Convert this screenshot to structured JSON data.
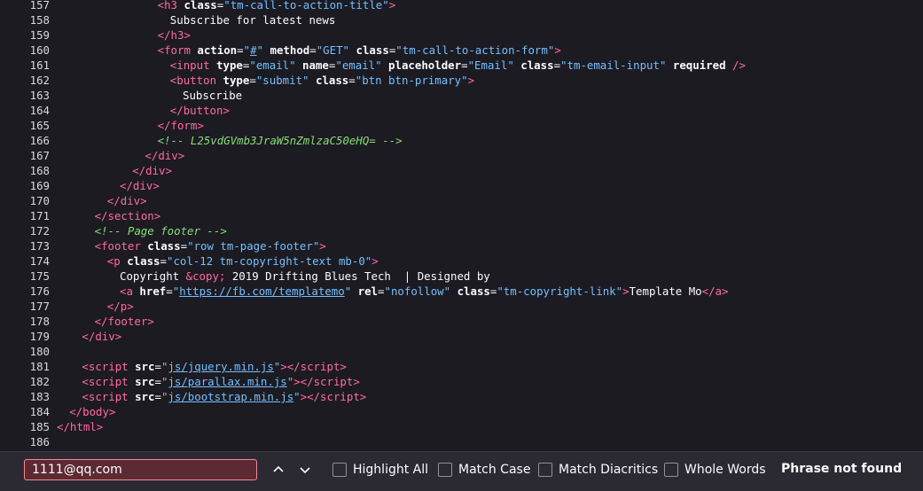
{
  "code": {
    "lines": [
      {
        "n": "157",
        "indent": 16,
        "parts": [
          [
            "b",
            "<"
          ],
          [
            "tag",
            "h3"
          ],
          [
            "t",
            " "
          ],
          [
            "attr",
            "class"
          ],
          [
            "t",
            "="
          ],
          [
            "val",
            "\"tm-call-to-action-title\""
          ],
          [
            "b",
            ">"
          ]
        ]
      },
      {
        "n": "158",
        "indent": 18,
        "parts": [
          [
            "t",
            "Subscribe for latest news"
          ]
        ]
      },
      {
        "n": "159",
        "indent": 16,
        "parts": [
          [
            "b",
            "</"
          ],
          [
            "tag",
            "h3"
          ],
          [
            "b",
            ">"
          ]
        ]
      },
      {
        "n": "160",
        "indent": 16,
        "parts": [
          [
            "b",
            "<"
          ],
          [
            "tag",
            "form"
          ],
          [
            "t",
            " "
          ],
          [
            "attr",
            "action"
          ],
          [
            "t",
            "="
          ],
          [
            "val",
            "\""
          ],
          [
            "lnk",
            "#"
          ],
          [
            "val",
            "\""
          ],
          [
            "t",
            " "
          ],
          [
            "attr",
            "method"
          ],
          [
            "t",
            "="
          ],
          [
            "val",
            "\"GET\""
          ],
          [
            "t",
            " "
          ],
          [
            "attr",
            "class"
          ],
          [
            "t",
            "="
          ],
          [
            "val",
            "\"tm-call-to-action-form\""
          ],
          [
            "b",
            ">"
          ]
        ]
      },
      {
        "n": "161",
        "indent": 18,
        "parts": [
          [
            "b",
            "<"
          ],
          [
            "tag",
            "input"
          ],
          [
            "t",
            " "
          ],
          [
            "attr",
            "type"
          ],
          [
            "t",
            "="
          ],
          [
            "val",
            "\"email\""
          ],
          [
            "t",
            " "
          ],
          [
            "attr",
            "name"
          ],
          [
            "t",
            "="
          ],
          [
            "val",
            "\"email\""
          ],
          [
            "t",
            " "
          ],
          [
            "attr",
            "placeholder"
          ],
          [
            "t",
            "="
          ],
          [
            "val",
            "\"Email\""
          ],
          [
            "t",
            " "
          ],
          [
            "attr",
            "class"
          ],
          [
            "t",
            "="
          ],
          [
            "val",
            "\"tm-email-input\""
          ],
          [
            "t",
            " "
          ],
          [
            "attr",
            "required"
          ],
          [
            "t",
            " "
          ],
          [
            "b",
            "/>"
          ]
        ]
      },
      {
        "n": "162",
        "indent": 18,
        "parts": [
          [
            "b",
            "<"
          ],
          [
            "tag",
            "button"
          ],
          [
            "t",
            " "
          ],
          [
            "attr",
            "type"
          ],
          [
            "t",
            "="
          ],
          [
            "val",
            "\"submit\""
          ],
          [
            "t",
            " "
          ],
          [
            "attr",
            "class"
          ],
          [
            "t",
            "="
          ],
          [
            "val",
            "\"btn btn-primary\""
          ],
          [
            "b",
            ">"
          ]
        ]
      },
      {
        "n": "163",
        "indent": 20,
        "parts": [
          [
            "t",
            "Subscribe"
          ]
        ]
      },
      {
        "n": "164",
        "indent": 18,
        "parts": [
          [
            "b",
            "</"
          ],
          [
            "tag",
            "button"
          ],
          [
            "b",
            ">"
          ]
        ]
      },
      {
        "n": "165",
        "indent": 16,
        "parts": [
          [
            "b",
            "</"
          ],
          [
            "tag",
            "form"
          ],
          [
            "b",
            ">"
          ]
        ]
      },
      {
        "n": "166",
        "indent": 16,
        "parts": [
          [
            "cmt",
            "<!-- L25vdGVmb3JraW5nZmlzaC50eHQ= -->"
          ]
        ]
      },
      {
        "n": "167",
        "indent": 14,
        "parts": [
          [
            "b",
            "</"
          ],
          [
            "tag",
            "div"
          ],
          [
            "b",
            ">"
          ]
        ]
      },
      {
        "n": "168",
        "indent": 12,
        "parts": [
          [
            "b",
            "</"
          ],
          [
            "tag",
            "div"
          ],
          [
            "b",
            ">"
          ]
        ]
      },
      {
        "n": "169",
        "indent": 10,
        "parts": [
          [
            "b",
            "</"
          ],
          [
            "tag",
            "div"
          ],
          [
            "b",
            ">"
          ]
        ]
      },
      {
        "n": "170",
        "indent": 8,
        "parts": [
          [
            "b",
            "</"
          ],
          [
            "tag",
            "div"
          ],
          [
            "b",
            ">"
          ]
        ]
      },
      {
        "n": "171",
        "indent": 6,
        "parts": [
          [
            "b",
            "</"
          ],
          [
            "tag",
            "section"
          ],
          [
            "b",
            ">"
          ]
        ]
      },
      {
        "n": "172",
        "indent": 6,
        "parts": [
          [
            "cmt",
            "<!-- Page footer -->"
          ]
        ]
      },
      {
        "n": "173",
        "indent": 6,
        "parts": [
          [
            "b",
            "<"
          ],
          [
            "tag",
            "footer"
          ],
          [
            "t",
            " "
          ],
          [
            "attr",
            "class"
          ],
          [
            "t",
            "="
          ],
          [
            "val",
            "\"row tm-page-footer\""
          ],
          [
            "b",
            ">"
          ]
        ]
      },
      {
        "n": "174",
        "indent": 8,
        "parts": [
          [
            "b",
            "<"
          ],
          [
            "tag",
            "p"
          ],
          [
            "t",
            " "
          ],
          [
            "attr",
            "class"
          ],
          [
            "t",
            "="
          ],
          [
            "val",
            "\"col-12 tm-copyright-text mb-0\""
          ],
          [
            "b",
            ">"
          ]
        ]
      },
      {
        "n": "175",
        "indent": 10,
        "parts": [
          [
            "t",
            "Copyright "
          ],
          [
            "tag",
            "&copy;"
          ],
          [
            "t",
            " 2019 Drifting Blues Tech  | Designed by"
          ]
        ]
      },
      {
        "n": "176",
        "indent": 10,
        "parts": [
          [
            "b",
            "<"
          ],
          [
            "tag",
            "a"
          ],
          [
            "t",
            " "
          ],
          [
            "attr",
            "href"
          ],
          [
            "t",
            "="
          ],
          [
            "val",
            "\""
          ],
          [
            "lnk",
            "https://fb.com/templatemo"
          ],
          [
            "val",
            "\""
          ],
          [
            "t",
            " "
          ],
          [
            "attr",
            "rel"
          ],
          [
            "t",
            "="
          ],
          [
            "val",
            "\"nofollow\""
          ],
          [
            "t",
            " "
          ],
          [
            "attr",
            "class"
          ],
          [
            "t",
            "="
          ],
          [
            "val",
            "\"tm-copyright-link\""
          ],
          [
            "b",
            ">"
          ],
          [
            "t",
            "Template Mo"
          ],
          [
            "b",
            "</"
          ],
          [
            "tag",
            "a"
          ],
          [
            "b",
            ">"
          ]
        ]
      },
      {
        "n": "177",
        "indent": 8,
        "parts": [
          [
            "b",
            "</"
          ],
          [
            "tag",
            "p"
          ],
          [
            "b",
            ">"
          ]
        ]
      },
      {
        "n": "178",
        "indent": 6,
        "parts": [
          [
            "b",
            "</"
          ],
          [
            "tag",
            "footer"
          ],
          [
            "b",
            ">"
          ]
        ]
      },
      {
        "n": "179",
        "indent": 4,
        "parts": [
          [
            "b",
            "</"
          ],
          [
            "tag",
            "div"
          ],
          [
            "b",
            ">"
          ]
        ]
      },
      {
        "n": "180",
        "indent": 0,
        "parts": []
      },
      {
        "n": "181",
        "indent": 4,
        "parts": [
          [
            "b",
            "<"
          ],
          [
            "tag",
            "script"
          ],
          [
            "t",
            " "
          ],
          [
            "attr",
            "src"
          ],
          [
            "t",
            "="
          ],
          [
            "val",
            "\""
          ],
          [
            "lnk",
            "js/jquery.min.js"
          ],
          [
            "val",
            "\""
          ],
          [
            "b",
            "></"
          ],
          [
            "tag",
            "script"
          ],
          [
            "b",
            ">"
          ]
        ]
      },
      {
        "n": "182",
        "indent": 4,
        "parts": [
          [
            "b",
            "<"
          ],
          [
            "tag",
            "script"
          ],
          [
            "t",
            " "
          ],
          [
            "attr",
            "src"
          ],
          [
            "t",
            "="
          ],
          [
            "val",
            "\""
          ],
          [
            "lnk",
            "js/parallax.min.js"
          ],
          [
            "val",
            "\""
          ],
          [
            "b",
            "></"
          ],
          [
            "tag",
            "script"
          ],
          [
            "b",
            ">"
          ]
        ]
      },
      {
        "n": "183",
        "indent": 4,
        "parts": [
          [
            "b",
            "<"
          ],
          [
            "tag",
            "script"
          ],
          [
            "t",
            " "
          ],
          [
            "attr",
            "src"
          ],
          [
            "t",
            "="
          ],
          [
            "val",
            "\""
          ],
          [
            "lnk",
            "js/bootstrap.min.js"
          ],
          [
            "val",
            "\""
          ],
          [
            "b",
            "></"
          ],
          [
            "tag",
            "script"
          ],
          [
            "b",
            ">"
          ]
        ]
      },
      {
        "n": "184",
        "indent": 2,
        "parts": [
          [
            "b",
            "</"
          ],
          [
            "tag",
            "body"
          ],
          [
            "b",
            ">"
          ]
        ]
      },
      {
        "n": "185",
        "indent": 0,
        "parts": [
          [
            "b",
            "</"
          ],
          [
            "tag",
            "html"
          ],
          [
            "b",
            ">"
          ]
        ]
      },
      {
        "n": "186",
        "indent": 0,
        "parts": []
      }
    ]
  },
  "findbar": {
    "query": "1111@qq.com",
    "prev_icon": "chevron-up-icon",
    "next_icon": "chevron-down-icon",
    "highlight_all": "Highlight All",
    "match_case": "Match Case",
    "match_diacritics": "Match Diacritics",
    "whole_words": "Whole Words",
    "status": "Phrase not found",
    "colors": {
      "input_bg": "#5c2a33",
      "input_border": "#ff848b",
      "bar_bg": "#2b2a33"
    }
  }
}
